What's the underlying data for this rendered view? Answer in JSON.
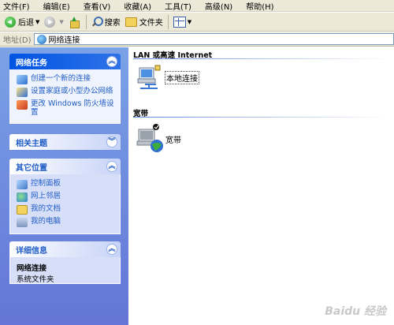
{
  "menu": [
    "文件(F)",
    "编辑(E)",
    "查看(V)",
    "收藏(A)",
    "工具(T)",
    "高级(N)",
    "帮助(H)"
  ],
  "toolbar": {
    "back_label": "后退",
    "search_label": "搜索",
    "folders_label": "文件夹"
  },
  "address": {
    "label": "地址(D)",
    "value": "网络连接"
  },
  "panels": {
    "network_tasks": {
      "title": "网络任务",
      "items": [
        "创建一个新的连接",
        "设置家庭或小型办公网络",
        "更改 Windows 防火墙设置"
      ]
    },
    "related_topics": {
      "title": "相关主题"
    },
    "other_places": {
      "title": "其它位置",
      "items": [
        "控制面板",
        "网上邻居",
        "我的文档",
        "我的电脑"
      ]
    },
    "details": {
      "title": "详细信息",
      "name": "网络连接",
      "type": "系统文件夹"
    }
  },
  "groups": {
    "lan": {
      "title": "LAN 或高速 Internet",
      "item": "本地连接"
    },
    "broadband": {
      "title": "宽带",
      "item": "宽带"
    }
  },
  "watermark": "Baidu 经验",
  "colors": {
    "pane_top": "#7ba2e7",
    "pane_bottom": "#6375d6",
    "link": "#215dc6",
    "special_header": "#0054e3"
  }
}
